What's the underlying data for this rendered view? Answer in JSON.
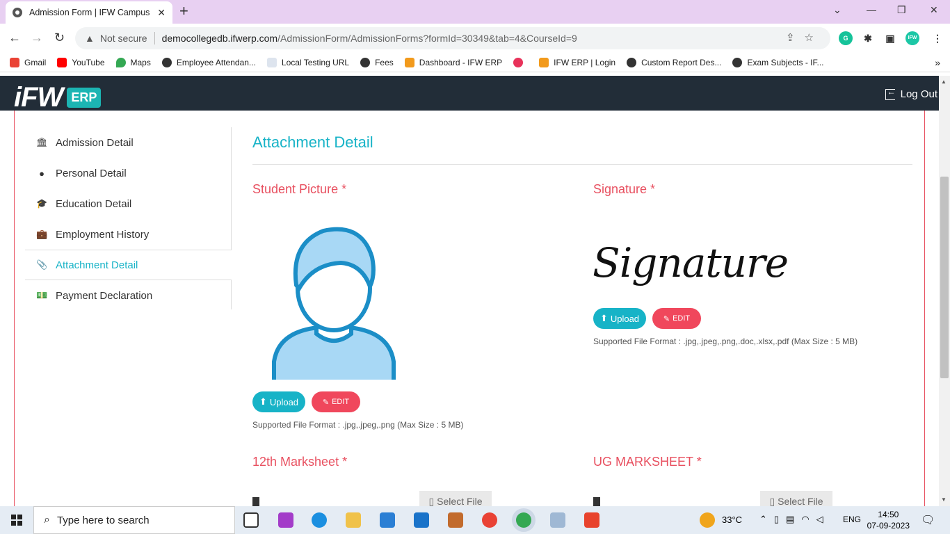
{
  "browser": {
    "tab_title": "Admission Form | IFW Campus",
    "close_tab": "✕",
    "new_tab": "+",
    "minimize": "⌄",
    "min_glyph": "—",
    "restore_glyph": "❐",
    "close_glyph": "✕",
    "not_secure": "Not secure",
    "url_domain": "democollegedb.ifwerp.com",
    "url_path": "/AdmissionForm/AdmissionForms?formId=30349&tab=4&CourseId=9",
    "bookmarks": [
      "Gmail",
      "YouTube",
      "Maps",
      "Employee Attendan...",
      "Local Testing URL",
      "Fees",
      "Dashboard - IFW ERP",
      "",
      "IFW ERP | Login",
      "Custom Report Des...",
      "Exam Subjects - IF..."
    ],
    "more": "»"
  },
  "app": {
    "logo_text": "iFW",
    "logo_badge": "ERP",
    "logout": "Log Out"
  },
  "sidebar": {
    "items": [
      {
        "label": "Admission Detail",
        "icon": "bank-icon"
      },
      {
        "label": "Personal Detail",
        "icon": "user-icon"
      },
      {
        "label": "Education Detail",
        "icon": "graduation-cap-icon"
      },
      {
        "label": "Employment History",
        "icon": "briefcase-icon"
      },
      {
        "label": "Attachment Detail",
        "icon": "paperclip-icon"
      },
      {
        "label": "Payment Declaration",
        "icon": "money-icon"
      }
    ],
    "active_index": 4
  },
  "main": {
    "section_title": "Attachment Detail",
    "student_picture_label": "Student Picture *",
    "signature_label": "Signature *",
    "signature_text": "Signature",
    "upload_label": "Upload",
    "edit_label": "EDIT",
    "picture_hint": "Supported File Format : .jpg,.jpeg,.png (Max Size : 5 MB)",
    "signature_hint": "Supported File Format : .jpg,.jpeg,.png,.doc,.xlsx,.pdf (Max Size : 5 MB)",
    "marksheet12_label": "12th Marksheet *",
    "ug_marksheet_label": "UG MARKSHEET *",
    "select_file": "Select File"
  },
  "taskbar": {
    "search_placeholder": "Type here to search",
    "temperature": "33°C",
    "language": "ENG",
    "time": "14:50",
    "date": "07-09-2023"
  },
  "colors": {
    "accent": "#17b3c7",
    "required_red": "#e85060",
    "edit_red": "#f0475c",
    "header_dark": "#222d38"
  }
}
